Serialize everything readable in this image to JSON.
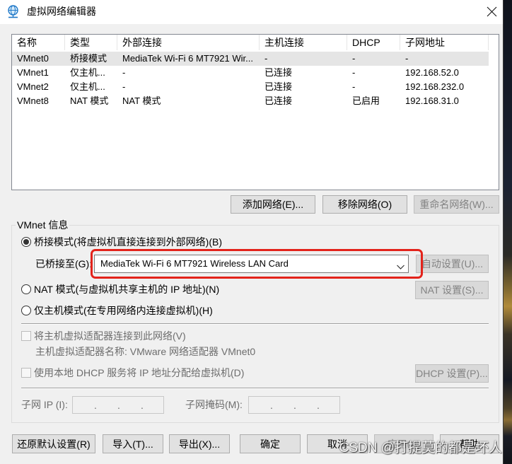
{
  "window": {
    "title": "虚拟网络编辑器",
    "title_icon": "network-globe-icon",
    "close_icon": "close-icon"
  },
  "network_table": {
    "columns": [
      "名称",
      "类型",
      "外部连接",
      "主机连接",
      "DHCP",
      "子网地址"
    ],
    "selected_row": 0,
    "rows": [
      {
        "name": "VMnet0",
        "type": "桥接模式",
        "external": "MediaTek Wi-Fi 6 MT7921 Wir...",
        "host": "-",
        "dhcp": "-",
        "subnet": "-"
      },
      {
        "name": "VMnet1",
        "type": "仅主机...",
        "external": "-",
        "host": "已连接",
        "dhcp": "-",
        "subnet": "192.168.52.0"
      },
      {
        "name": "VMnet2",
        "type": "仅主机...",
        "external": "-",
        "host": "已连接",
        "dhcp": "-",
        "subnet": "192.168.232.0"
      },
      {
        "name": "VMnet8",
        "type": "NAT 模式",
        "external": "NAT 模式",
        "host": "已连接",
        "dhcp": "已启用",
        "subnet": "192.168.31.0"
      }
    ]
  },
  "table_buttons": {
    "add_network": {
      "label": "添加网络(E)...",
      "disabled": false
    },
    "remove_network": {
      "label": "移除网络(O)",
      "disabled": false
    },
    "rename_network": {
      "label": "重命名网络(W)...",
      "disabled": true
    }
  },
  "vmnet_info": {
    "group_label": "VMnet 信息",
    "bridged": {
      "label": "桥接模式(将虚拟机直接连接到外部网络)(B)",
      "checked": true
    },
    "bridged_to_label": "已桥接至(G):",
    "bridged_to_select": {
      "value": "MediaTek Wi-Fi 6 MT7921 Wireless LAN Card",
      "icon": "chevron-down-icon"
    },
    "auto_settings": {
      "label": "自动设置(U)...",
      "disabled": true
    },
    "nat": {
      "label": "NAT 模式(与虚拟机共享主机的 IP 地址)(N)",
      "checked": false
    },
    "nat_settings": {
      "label": "NAT 设置(S)...",
      "disabled": true
    },
    "host_only": {
      "label": "仅主机模式(在专用网络内连接虚拟机)(H)",
      "checked": false
    },
    "connect_adapter": {
      "label": "将主机虚拟适配器连接到此网络(V)",
      "checked": false,
      "disabled": true
    },
    "adapter_name": "主机虚拟适配器名称: VMware 网络适配器 VMnet0",
    "dhcp_service": {
      "label": "使用本地 DHCP 服务将 IP 地址分配给虚拟机(D)",
      "checked": false,
      "disabled": true
    },
    "dhcp_settings": {
      "label": "DHCP 设置(P)...",
      "disabled": true
    },
    "subnet_ip": {
      "label": "子网 IP (I):",
      "separator": ".",
      "disabled": true
    },
    "subnet_mask": {
      "label": "子网掩码(M):",
      "separator": ".",
      "disabled": true
    }
  },
  "footer_buttons": {
    "restore_defaults": {
      "label": "还原默认设置(R)",
      "disabled": false
    },
    "import": {
      "label": "导入(T)...",
      "disabled": false
    },
    "export": {
      "label": "导出(X)...",
      "disabled": false
    },
    "ok": {
      "label": "确定",
      "disabled": false
    },
    "cancel": {
      "label": "取消",
      "disabled": false
    },
    "apply": {
      "label": "应用(A)",
      "disabled": true
    },
    "help": {
      "label": "帮助",
      "disabled": false
    }
  },
  "watermark": "CSDN @打提莫的都是坏人",
  "colors": {
    "window_bg": "#f0f0f0",
    "selected_row": "#e5e5e5",
    "highlight": "#e3231b",
    "disabled_text": "#838383"
  }
}
